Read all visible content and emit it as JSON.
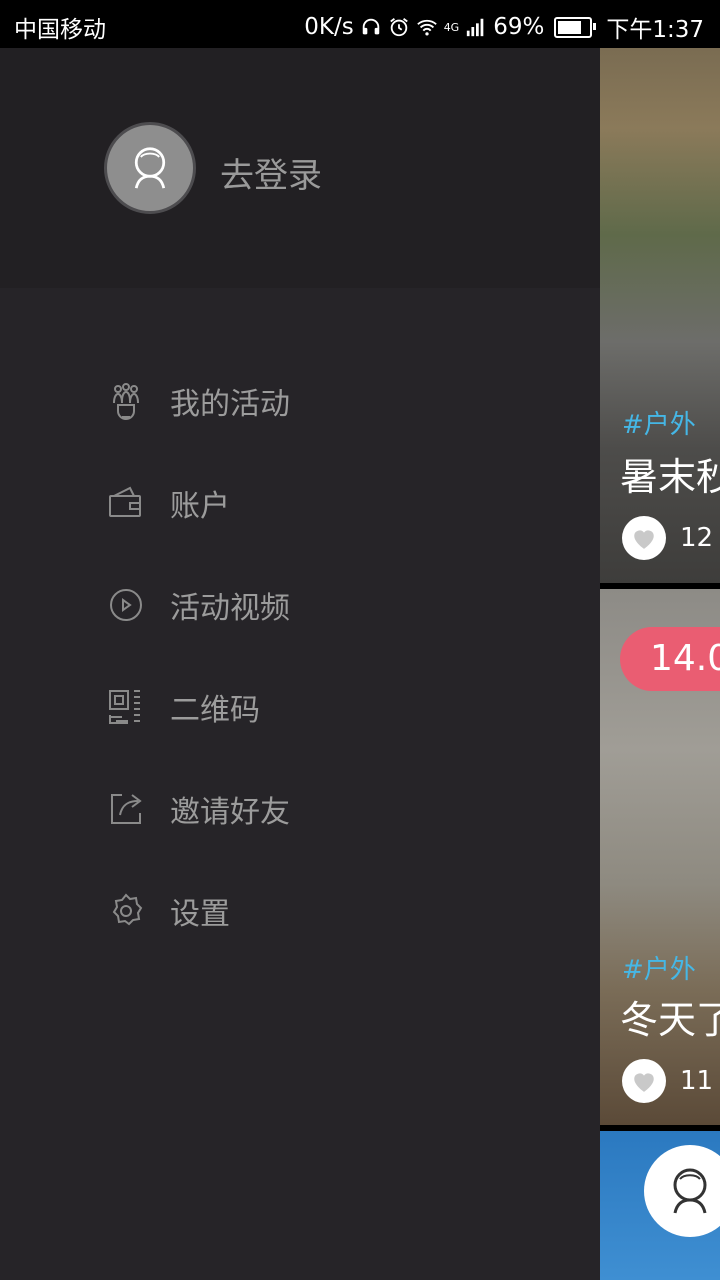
{
  "status_bar": {
    "carrier": "中国移动",
    "net_speed": "0K/s",
    "network": "4G",
    "battery": "69%",
    "time": "下午1:37"
  },
  "drawer": {
    "login_label": "去登录",
    "menu": [
      {
        "label": "我的活动",
        "icon": "people-icon"
      },
      {
        "label": "账户",
        "icon": "wallet-icon"
      },
      {
        "label": "活动视频",
        "icon": "play-icon"
      },
      {
        "label": "二维码",
        "icon": "qrcode-icon"
      },
      {
        "label": "邀请好友",
        "icon": "share-icon"
      },
      {
        "label": "设置",
        "icon": "gear-icon"
      }
    ]
  },
  "feed": {
    "cards": [
      {
        "tag": "#户外",
        "title": "暑末秒",
        "likes": "12"
      },
      {
        "price": "14.0",
        "tag": "#户外",
        "title": "冬天了",
        "likes": "11"
      }
    ]
  }
}
